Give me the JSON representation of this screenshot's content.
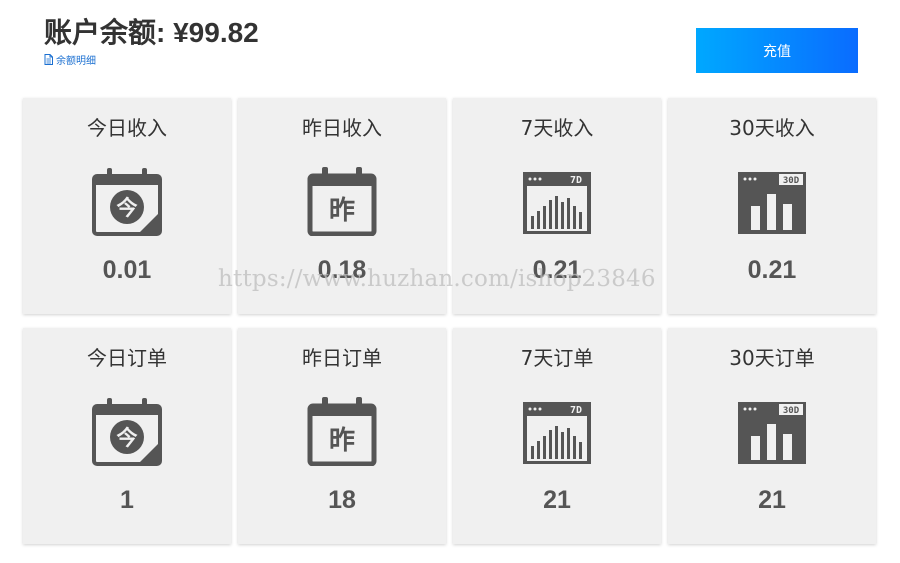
{
  "header": {
    "balance_label": "账户余额: ¥99.82",
    "detail_link": "余额明细",
    "recharge_button": "充值"
  },
  "cards": [
    {
      "label": "今日收入",
      "value": "0.01",
      "icon": "calendar-today-icon",
      "icon_text": "今"
    },
    {
      "label": "昨日收入",
      "value": "0.18",
      "icon": "calendar-yesterday-icon",
      "icon_text": "昨"
    },
    {
      "label": "7天收入",
      "value": "0.21",
      "icon": "bar-chart-7d-icon",
      "icon_text": "7D"
    },
    {
      "label": "30天收入",
      "value": "0.21",
      "icon": "bar-chart-30d-icon",
      "icon_text": "30D"
    },
    {
      "label": "今日订单",
      "value": "1",
      "icon": "calendar-today-icon",
      "icon_text": "今"
    },
    {
      "label": "昨日订单",
      "value": "18",
      "icon": "calendar-yesterday-icon",
      "icon_text": "昨"
    },
    {
      "label": "7天订单",
      "value": "21",
      "icon": "bar-chart-7d-icon",
      "icon_text": "7D"
    },
    {
      "label": "30天订单",
      "value": "21",
      "icon": "bar-chart-30d-icon",
      "icon_text": "30D"
    }
  ],
  "watermark": "https://www.huzhan.com/ishop23846",
  "colors": {
    "accent_start": "#00a8ff",
    "accent_end": "#0a6cff",
    "card_bg": "#f0f0f0",
    "icon": "#555555",
    "link": "#1a6fd1"
  }
}
